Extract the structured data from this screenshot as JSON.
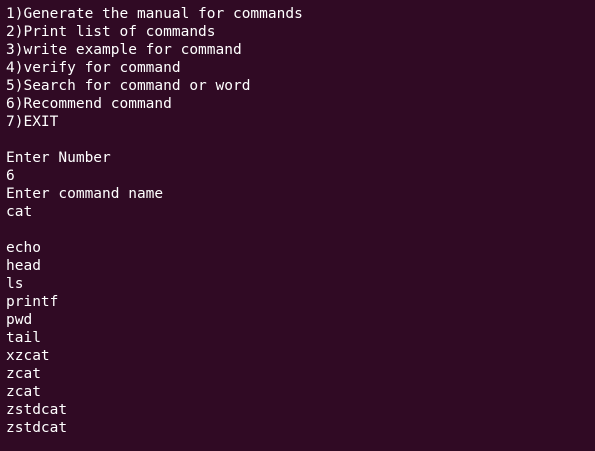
{
  "theme": {
    "background": "#300a24",
    "foreground": "#ffffff"
  },
  "menu": {
    "items": [
      "1)Generate the manual for commands",
      "2)Print list of commands",
      "3)write example for command",
      "4)verify for command",
      "5)Search for command or word",
      "6)Recommend command",
      "7)EXIT"
    ]
  },
  "session": {
    "prompt_number": "Enter Number",
    "input_number": "6",
    "prompt_command": "Enter command name",
    "input_command": "cat"
  },
  "output": {
    "lines": [
      "echo",
      "head",
      "ls",
      "printf",
      "pwd",
      "tail",
      "xzcat",
      "zcat",
      "zcat",
      "zstdcat",
      "zstdcat"
    ]
  }
}
